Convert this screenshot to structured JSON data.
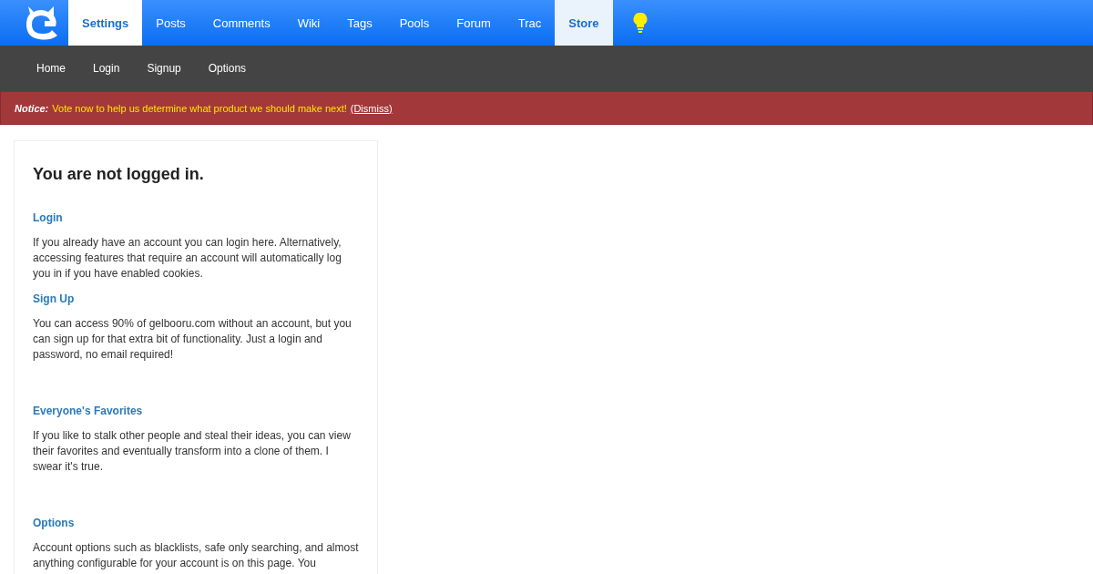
{
  "top_nav": {
    "tabs": [
      {
        "label": "Settings",
        "selected": true,
        "highlighted": false
      },
      {
        "label": "Posts",
        "selected": false,
        "highlighted": false
      },
      {
        "label": "Comments",
        "selected": false,
        "highlighted": false
      },
      {
        "label": "Wiki",
        "selected": false,
        "highlighted": false
      },
      {
        "label": "Tags",
        "selected": false,
        "highlighted": false
      },
      {
        "label": "Pools",
        "selected": false,
        "highlighted": false
      },
      {
        "label": "Forum",
        "selected": false,
        "highlighted": false
      },
      {
        "label": "Trac",
        "selected": false,
        "highlighted": false
      },
      {
        "label": "Store",
        "selected": false,
        "highlighted": true
      }
    ]
  },
  "sub_nav": {
    "items": [
      "Home",
      "Login",
      "Signup",
      "Options"
    ]
  },
  "notice": {
    "label": "Notice:",
    "message": "Vote now to help us determine what product we should make next!",
    "link": "(Dismiss)"
  },
  "panel": {
    "title": "You are not logged in.",
    "groups": [
      {
        "sections": [
          {
            "heading": "Login",
            "text": "If you already have an account you can login here. Alternatively, accessing features that require an account will automatically log you in if you have enabled cookies."
          },
          {
            "heading": "Sign Up",
            "text": "You can access 90% of gelbooru.com without an account, but you can sign up for that extra bit of functionality. Just a login and password, no email required!"
          }
        ]
      },
      {
        "sections": [
          {
            "heading": "Everyone's Favorites",
            "text": "If you like to stalk other people and steal their ideas, you can view their favorites and eventually transform into a clone of them. I swear it's true."
          }
        ]
      },
      {
        "sections": [
          {
            "heading": "Options",
            "text": "Account options such as blacklists, safe only searching, and almost anything configurable for your account is on this page. You"
          }
        ]
      }
    ]
  }
}
